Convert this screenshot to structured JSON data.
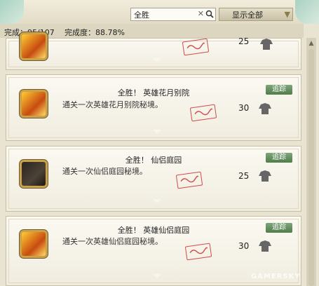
{
  "search": {
    "value": "全胜",
    "clear_symbol": "✕"
  },
  "filter": {
    "label": "显示全部",
    "caret": "▼"
  },
  "progress": {
    "completed_label": "完成：95/107",
    "rate_label": "完成度：88.78%"
  },
  "cards": [
    {
      "title": "",
      "desc": "",
      "points": "25",
      "trace_label": ""
    },
    {
      "title": "全胜！ 英雄花月别院",
      "desc": "通关一次英雄花月别院秘境。",
      "points": "30",
      "trace_label": "追踪"
    },
    {
      "title": "全胜！ 仙侣庭园",
      "desc": "通关一次仙侣庭园秘境。",
      "points": "25",
      "trace_label": "追踪"
    },
    {
      "title": "全胜！ 英雄仙侣庭园",
      "desc": "通关一次英雄仙侣庭园秘境。",
      "points": "30",
      "trace_label": "追踪"
    }
  ],
  "watermark": "GAMERSKY",
  "icons": {
    "search": "search-icon",
    "clear": "clear-icon",
    "dropdown": "chevron-down-icon",
    "achievement_gold": "fire-sword-icon",
    "achievement_dark": "scroll-icon",
    "stamp": "completed-stamp-icon",
    "points": "robe-icon"
  },
  "colors": {
    "trace_button": "#4f7c4b",
    "stamp": "#d24a4a",
    "background": "#e9e4d2"
  }
}
